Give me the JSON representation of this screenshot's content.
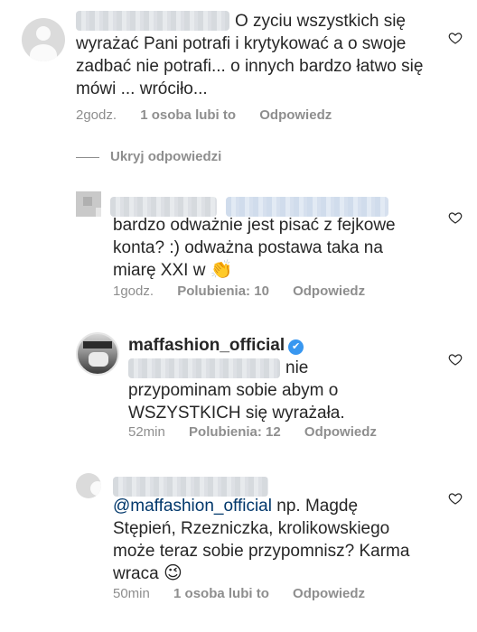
{
  "comments": [
    {
      "text": "O zyciu wszystkich się wyrażać Pani potrafi i krytykować a o swoje zadbać nie potrafi... o innych bardzo łatwo się mówi ... wróciło...",
      "time": "2godz.",
      "likes": "1 osoba lubi to",
      "reply": "Odpowiedz"
    }
  ],
  "hide_replies": "Ukryj odpowiedzi",
  "replies": [
    {
      "text_1": "bardzo odważnie jest pisać z fejkowe konta? :) odważna postawa taka na miarę XXI w",
      "emoji": "👏",
      "time": "1godz.",
      "likes": "Polubienia: 10",
      "reply": "Odpowiedz"
    },
    {
      "username": "maffashion_official",
      "verified_icon": "✔",
      "text_1": "nie",
      "text_2": "przypominam sobie abym o WSZYSTKICH się wyrażała.",
      "time": "52min",
      "likes": "Polubienia: 12",
      "reply": "Odpowiedz"
    },
    {
      "mention": "@maffashion_official",
      "text": " np. Magdę Stępień, Rzezniczka, krolikowskiego może teraz sobie przypomnisz? Karma wraca",
      "emoji": "😉",
      "time": "50min",
      "likes": "1 osoba lubi to",
      "reply": "Odpowiedz"
    }
  ],
  "icons": {
    "heart": "heart-outline-icon",
    "avatar_default": "default-avatar-icon"
  },
  "colors": {
    "text": "#262626",
    "meta": "#8e8e8e",
    "mention": "#00376b",
    "verified": "#3897f0"
  }
}
